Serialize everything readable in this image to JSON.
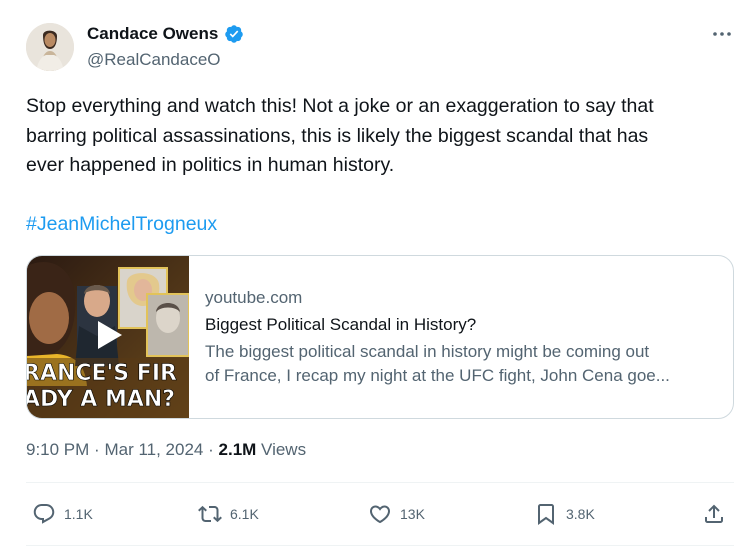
{
  "author": {
    "name": "Candace Owens",
    "handle": "@RealCandaceO",
    "verified": true
  },
  "tweet": {
    "text_lines": [
      "Stop everything and watch this! Not a joke or an exaggeration to say that",
      "barring political assassinations, this is likely the biggest scandal that has",
      "ever happened in politics in human history."
    ],
    "hashtag": "#JeanMichelTrogneux"
  },
  "card": {
    "domain": "youtube.com",
    "title": "Biggest Political Scandal in History?",
    "description_lines": [
      "The biggest political scandal in history might be coming out",
      "of France, I recap my night at the UFC fight, John Cena goe..."
    ],
    "thumbnail_text_line1": "RANCE'S FIR",
    "thumbnail_text_line2": "ADY A MAN?"
  },
  "meta": {
    "time": "9:10 PM",
    "separator1": "·",
    "date": "Mar 11, 2024",
    "separator2": "·",
    "views_count": "2.1M",
    "views_label": "Views"
  },
  "actions": {
    "replies": "1.1K",
    "reposts": "6.1K",
    "likes": "13K",
    "bookmarks": "3.8K"
  },
  "colors": {
    "link_blue": "#1d9bf0",
    "secondary_text": "#536471",
    "primary_text": "#0f1419",
    "verified_badge": "#1d9bf0",
    "divider": "#eff3f4"
  },
  "icons": {
    "verified": "verified-badge-icon",
    "more": "more-options-icon",
    "play": "play-icon",
    "reply": "reply-icon",
    "repost": "repost-icon",
    "like": "heart-icon",
    "bookmark": "bookmark-icon",
    "share": "share-icon"
  }
}
